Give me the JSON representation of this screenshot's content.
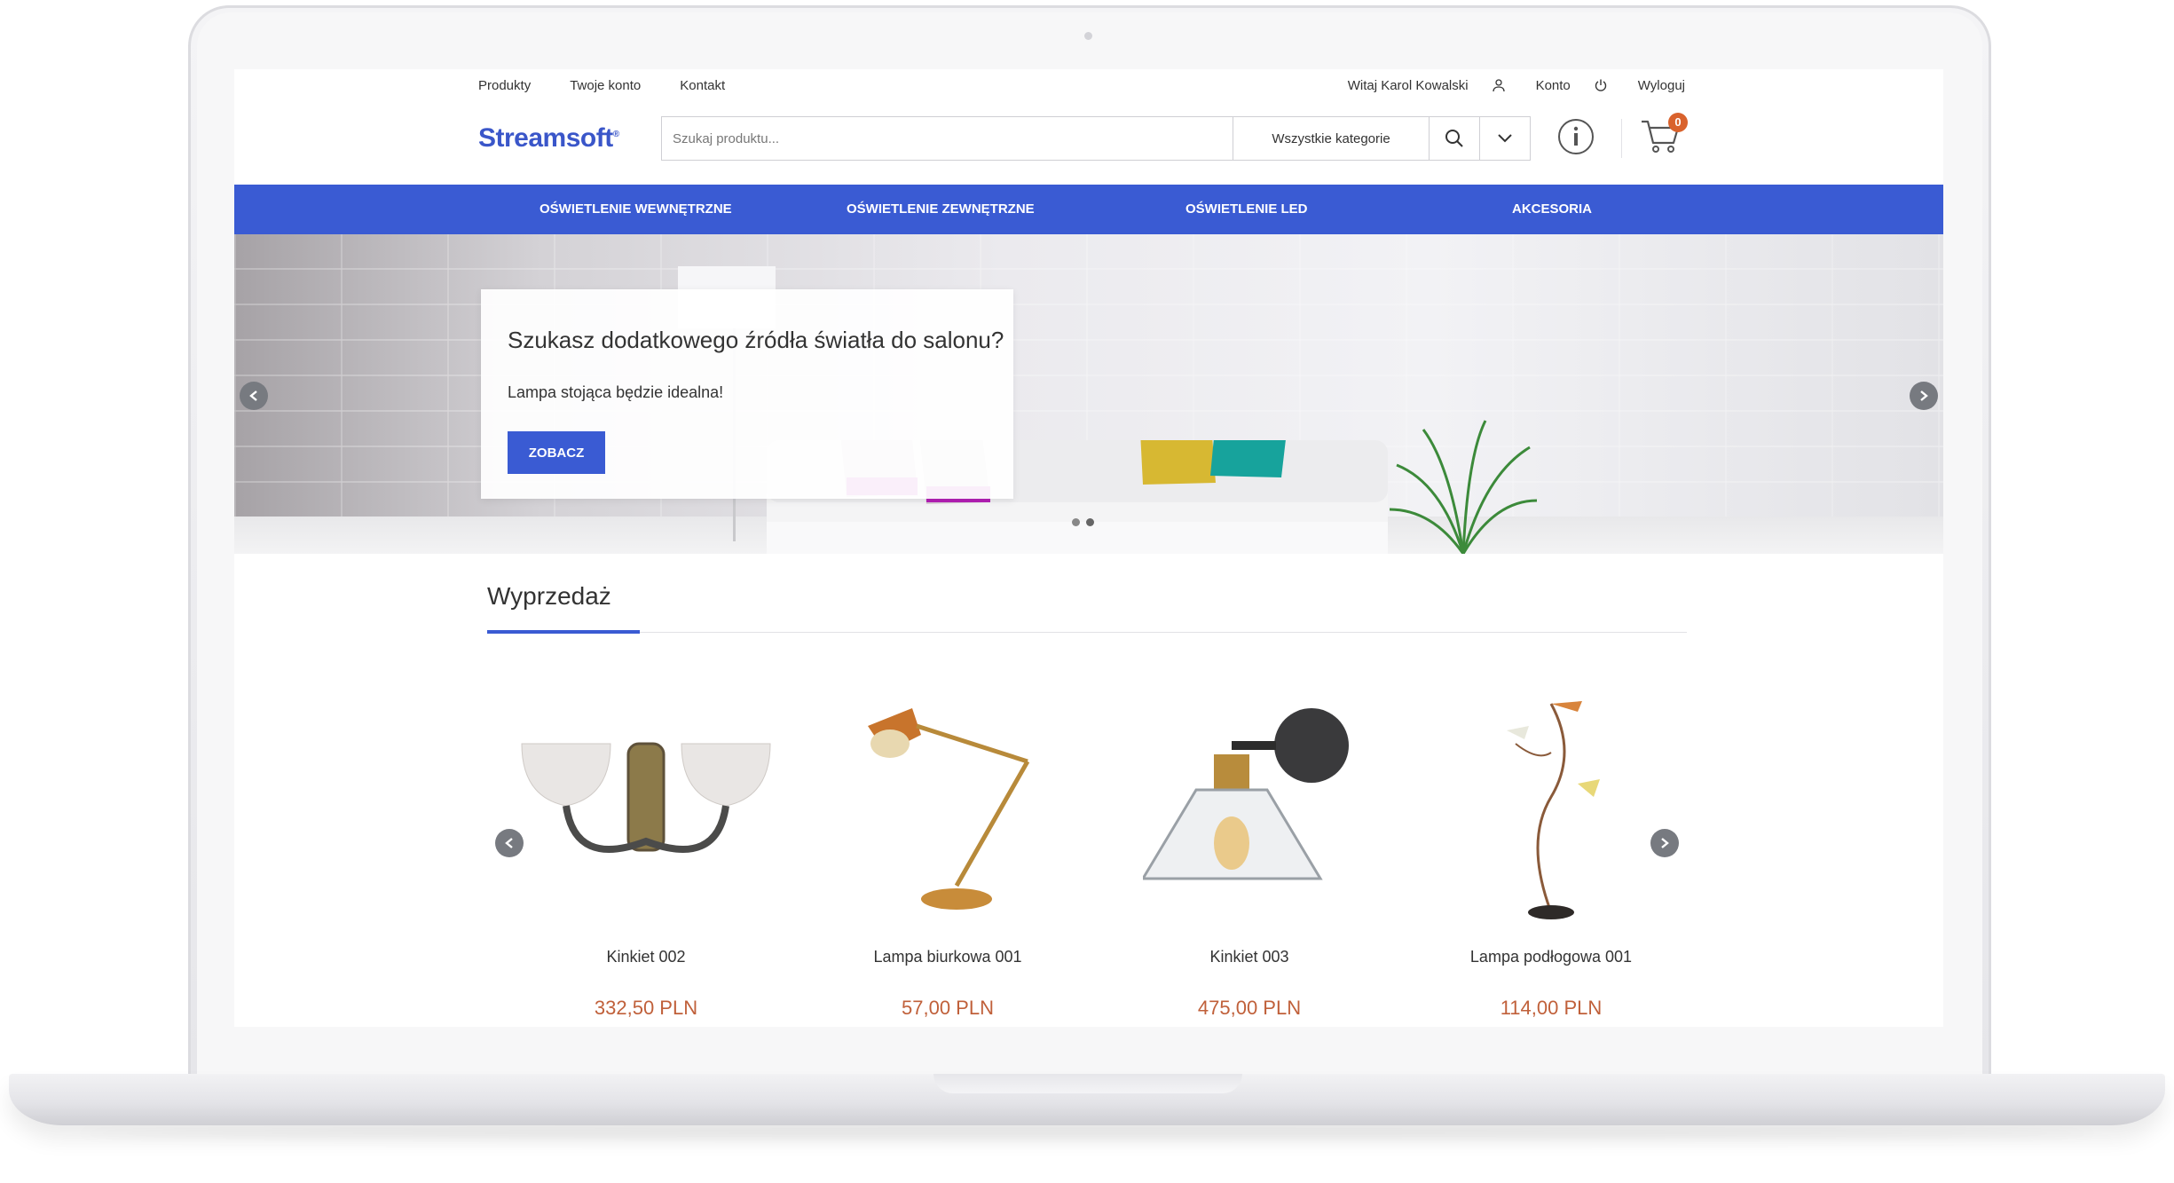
{
  "top_links": [
    "Produkty",
    "Twoje konto",
    "Kontakt"
  ],
  "user": {
    "greeting": "Witaj Karol Kowalski",
    "account": "Konto",
    "logout": "Wyloguj"
  },
  "logo": "Streamsoft",
  "search": {
    "placeholder": "Szukaj produktu...",
    "category": "Wszystkie kategorie"
  },
  "cart": {
    "count": "0"
  },
  "nav": [
    "OŚWIETLENIE WEWNĘTRZNE",
    "OŚWIETLENIE ZEWNĘTRZNE",
    "OŚWIETLENIE LED",
    "AKCESORIA"
  ],
  "hero": {
    "heading": "Szukasz dodatkowego źródła światła do salonu?",
    "text": "Lampa stojąca będzie idealna!",
    "button": "ZOBACZ"
  },
  "sale": {
    "title": "Wyprzedaż",
    "products": [
      {
        "name": "Kinkiet 002",
        "price": "332,50 PLN"
      },
      {
        "name": "Lampa biurkowa 001",
        "price": "57,00 PLN"
      },
      {
        "name": "Kinkiet 003",
        "price": "475,00 PLN"
      },
      {
        "name": "Lampa podłogowa 001",
        "price": "114,00 PLN"
      }
    ]
  },
  "colors": {
    "accent": "#3a5bd3",
    "price": "#c0603a",
    "badge": "#d9622c",
    "logo": "#3a56c9"
  }
}
